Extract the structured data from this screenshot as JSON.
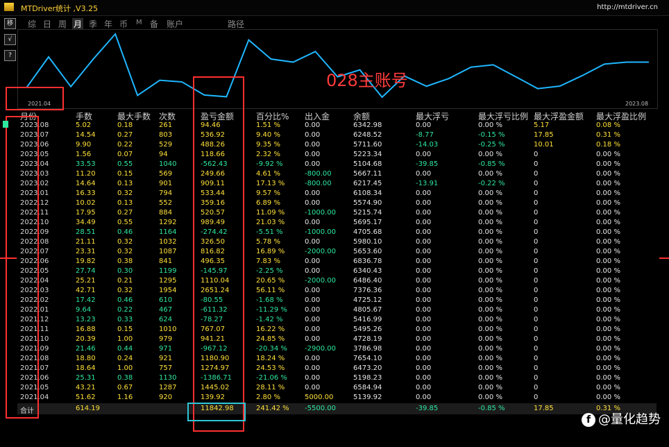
{
  "window": {
    "title": "MTDriver统计 ,V3.25",
    "url": "http://mtdriver.cn"
  },
  "toolbar": {
    "btn1": "移",
    "btn2": "√",
    "btn3": "?"
  },
  "nav": [
    "综",
    "日",
    "周",
    "月",
    "季",
    "年",
    "币",
    "M",
    "备",
    "账户",
    "路径"
  ],
  "nav_active": "月",
  "chart": {
    "start_label": "2021.04",
    "end_label": "2023.08",
    "account_label": "028主账号"
  },
  "chart_data": {
    "type": "line",
    "x": [
      "2021.04",
      "2021.05",
      "2021.06",
      "2021.07",
      "2021.08",
      "2021.09",
      "2021.10",
      "2021.11",
      "2021.12",
      "2022.01",
      "2022.02",
      "2022.03",
      "2022.04",
      "2022.05",
      "2022.06",
      "2022.07",
      "2022.08",
      "2022.09",
      "2022.10",
      "2022.11",
      "2022.12",
      "2023.01",
      "2023.02",
      "2023.03",
      "2023.04",
      "2023.05",
      "2023.06",
      "2023.07",
      "2023.08"
    ],
    "values": [
      5139.92,
      6584.94,
      5198.23,
      6473.2,
      7654.1,
      4786.98,
      5495.26,
      5416.99,
      4805.67,
      4725.12,
      7376.36,
      6486.4,
      6340.43,
      6836.78,
      5653.6,
      5980.1,
      4705.68,
      5695.17,
      5215.74,
      5574.9,
      6108.34,
      6217.45,
      5667.11,
      5104.68,
      5223.34,
      5711.6,
      6248.52,
      6342.98,
      6342.98
    ],
    "series_color": "#1fb6ff"
  },
  "table": {
    "headers": [
      "月份",
      "手数",
      "最大手数",
      "次数",
      "盈亏金额",
      "百分比%",
      "出入金",
      "余额",
      "最大浮亏",
      "最大浮亏比例",
      "最大浮盈金额",
      "最大浮盈比例"
    ],
    "rows": [
      {
        "month": "2023.08",
        "lots": "5.02",
        "max_lots": "0.18",
        "count": "261",
        "pl": "94.46",
        "pct": "1.51 %",
        "io": "0.00",
        "bal": "6342.98",
        "mdd": "0.00",
        "mdd_pct": "0.00 %",
        "mfp": "5.17",
        "mfp_pct": "0.08 %",
        "c": "y"
      },
      {
        "month": "2023.07",
        "lots": "14.54",
        "max_lots": "0.27",
        "count": "803",
        "pl": "536.92",
        "pct": "9.40 %",
        "io": "0.00",
        "bal": "6248.52",
        "mdd": "-8.77",
        "mdd_pct": "-0.15 %",
        "mfp": "17.85",
        "mfp_pct": "0.31 %",
        "c": "y"
      },
      {
        "month": "2023.06",
        "lots": "9.90",
        "max_lots": "0.22",
        "count": "529",
        "pl": "488.26",
        "pct": "9.35 %",
        "io": "0.00",
        "bal": "5711.60",
        "mdd": "-14.03",
        "mdd_pct": "-0.25 %",
        "mfp": "10.01",
        "mfp_pct": "0.18 %",
        "c": "y"
      },
      {
        "month": "2023.05",
        "lots": "1.56",
        "max_lots": "0.07",
        "count": "94",
        "pl": "118.66",
        "pct": "2.32 %",
        "io": "0.00",
        "bal": "5223.34",
        "mdd": "0.00",
        "mdd_pct": "0.00 %",
        "mfp": "0",
        "mfp_pct": "0.00 %",
        "c": "y"
      },
      {
        "month": "2023.04",
        "lots": "33.53",
        "max_lots": "0.55",
        "count": "1040",
        "pl": "-562.43",
        "pct": "-9.92 %",
        "io": "0.00",
        "bal": "5104.68",
        "mdd": "-39.85",
        "mdd_pct": "-0.85 %",
        "mfp": "0",
        "mfp_pct": "0.00 %",
        "c": "g"
      },
      {
        "month": "2023.03",
        "lots": "11.20",
        "max_lots": "0.15",
        "count": "569",
        "pl": "249.66",
        "pct": "4.61 %",
        "io": "-800.00",
        "bal": "5667.11",
        "mdd": "0.00",
        "mdd_pct": "0.00 %",
        "mfp": "0",
        "mfp_pct": "0.00 %",
        "c": "y"
      },
      {
        "month": "2023.02",
        "lots": "14.64",
        "max_lots": "0.13",
        "count": "901",
        "pl": "909.11",
        "pct": "17.13 %",
        "io": "-800.00",
        "bal": "6217.45",
        "mdd": "-13.91",
        "mdd_pct": "-0.22 %",
        "mfp": "0",
        "mfp_pct": "0.00 %",
        "c": "y"
      },
      {
        "month": "2023.01",
        "lots": "16.33",
        "max_lots": "0.32",
        "count": "794",
        "pl": "533.44",
        "pct": "9.57 %",
        "io": "0.00",
        "bal": "6108.34",
        "mdd": "0.00",
        "mdd_pct": "0.00 %",
        "mfp": "0",
        "mfp_pct": "0.00 %",
        "c": "y"
      },
      {
        "month": "2022.12",
        "lots": "10.02",
        "max_lots": "0.13",
        "count": "552",
        "pl": "359.16",
        "pct": "6.89 %",
        "io": "0.00",
        "bal": "5574.90",
        "mdd": "0.00",
        "mdd_pct": "0.00 %",
        "mfp": "0",
        "mfp_pct": "0.00 %",
        "c": "y"
      },
      {
        "month": "2022.11",
        "lots": "17.95",
        "max_lots": "0.27",
        "count": "884",
        "pl": "520.57",
        "pct": "11.09 %",
        "io": "-1000.00",
        "bal": "5215.74",
        "mdd": "0.00",
        "mdd_pct": "0.00 %",
        "mfp": "0",
        "mfp_pct": "0.00 %",
        "c": "y"
      },
      {
        "month": "2022.10",
        "lots": "34.49",
        "max_lots": "0.55",
        "count": "1292",
        "pl": "989.49",
        "pct": "21.03 %",
        "io": "0.00",
        "bal": "5695.17",
        "mdd": "0.00",
        "mdd_pct": "0.00 %",
        "mfp": "0",
        "mfp_pct": "0.00 %",
        "c": "y"
      },
      {
        "month": "2022.09",
        "lots": "28.51",
        "max_lots": "0.46",
        "count": "1164",
        "pl": "-274.42",
        "pct": "-5.51 %",
        "io": "-1000.00",
        "bal": "4705.68",
        "mdd": "0.00",
        "mdd_pct": "0.00 %",
        "mfp": "0",
        "mfp_pct": "0.00 %",
        "c": "g"
      },
      {
        "month": "2022.08",
        "lots": "21.11",
        "max_lots": "0.32",
        "count": "1032",
        "pl": "326.50",
        "pct": "5.78 %",
        "io": "0.00",
        "bal": "5980.10",
        "mdd": "0.00",
        "mdd_pct": "0.00 %",
        "mfp": "0",
        "mfp_pct": "0.00 %",
        "c": "y"
      },
      {
        "month": "2022.07",
        "lots": "23.31",
        "max_lots": "0.32",
        "count": "1087",
        "pl": "816.82",
        "pct": "16.89 %",
        "io": "-2000.00",
        "bal": "5653.60",
        "mdd": "0.00",
        "mdd_pct": "0.00 %",
        "mfp": "0",
        "mfp_pct": "0.00 %",
        "c": "y"
      },
      {
        "month": "2022.06",
        "lots": "19.82",
        "max_lots": "0.38",
        "count": "841",
        "pl": "496.35",
        "pct": "7.83 %",
        "io": "0.00",
        "bal": "6836.78",
        "mdd": "0.00",
        "mdd_pct": "0.00 %",
        "mfp": "0",
        "mfp_pct": "0.00 %",
        "c": "y"
      },
      {
        "month": "2022.05",
        "lots": "27.74",
        "max_lots": "0.30",
        "count": "1199",
        "pl": "-145.97",
        "pct": "-2.25 %",
        "io": "0.00",
        "bal": "6340.43",
        "mdd": "0.00",
        "mdd_pct": "0.00 %",
        "mfp": "0",
        "mfp_pct": "0.00 %",
        "c": "g"
      },
      {
        "month": "2022.04",
        "lots": "25.21",
        "max_lots": "0.21",
        "count": "1295",
        "pl": "1110.04",
        "pct": "20.65 %",
        "io": "-2000.00",
        "bal": "6486.40",
        "mdd": "0.00",
        "mdd_pct": "0.00 %",
        "mfp": "0",
        "mfp_pct": "0.00 %",
        "c": "y"
      },
      {
        "month": "2022.03",
        "lots": "42.71",
        "max_lots": "0.32",
        "count": "1954",
        "pl": "2651.24",
        "pct": "56.11 %",
        "io": "0.00",
        "bal": "7376.36",
        "mdd": "0.00",
        "mdd_pct": "0.00 %",
        "mfp": "0",
        "mfp_pct": "0.00 %",
        "c": "y"
      },
      {
        "month": "2022.02",
        "lots": "17.42",
        "max_lots": "0.46",
        "count": "610",
        "pl": "-80.55",
        "pct": "-1.68 %",
        "io": "0.00",
        "bal": "4725.12",
        "mdd": "0.00",
        "mdd_pct": "0.00 %",
        "mfp": "0",
        "mfp_pct": "0.00 %",
        "c": "g"
      },
      {
        "month": "2022.01",
        "lots": "9.64",
        "max_lots": "0.22",
        "count": "467",
        "pl": "-611.32",
        "pct": "-11.29 %",
        "io": "0.00",
        "bal": "4805.67",
        "mdd": "0.00",
        "mdd_pct": "0.00 %",
        "mfp": "0",
        "mfp_pct": "0.00 %",
        "c": "g"
      },
      {
        "month": "2021.12",
        "lots": "13.23",
        "max_lots": "0.33",
        "count": "624",
        "pl": "-78.27",
        "pct": "-1.42 %",
        "io": "0.00",
        "bal": "5416.99",
        "mdd": "0.00",
        "mdd_pct": "0.00 %",
        "mfp": "0",
        "mfp_pct": "0.00 %",
        "c": "g"
      },
      {
        "month": "2021.11",
        "lots": "16.88",
        "max_lots": "0.15",
        "count": "1010",
        "pl": "767.07",
        "pct": "16.22 %",
        "io": "0.00",
        "bal": "5495.26",
        "mdd": "0.00",
        "mdd_pct": "0.00 %",
        "mfp": "0",
        "mfp_pct": "0.00 %",
        "c": "y"
      },
      {
        "month": "2021.10",
        "lots": "20.39",
        "max_lots": "1.00",
        "count": "979",
        "pl": "941.21",
        "pct": "24.85 %",
        "io": "0.00",
        "bal": "4728.19",
        "mdd": "0.00",
        "mdd_pct": "0.00 %",
        "mfp": "0",
        "mfp_pct": "0.00 %",
        "c": "y"
      },
      {
        "month": "2021.09",
        "lots": "21.46",
        "max_lots": "0.44",
        "count": "971",
        "pl": "-967.12",
        "pct": "-20.34 %",
        "io": "-2900.00",
        "bal": "3786.98",
        "mdd": "0.00",
        "mdd_pct": "0.00 %",
        "mfp": "0",
        "mfp_pct": "0.00 %",
        "c": "g"
      },
      {
        "month": "2021.08",
        "lots": "18.80",
        "max_lots": "0.24",
        "count": "921",
        "pl": "1180.90",
        "pct": "18.24 %",
        "io": "0.00",
        "bal": "7654.10",
        "mdd": "0.00",
        "mdd_pct": "0.00 %",
        "mfp": "0",
        "mfp_pct": "0.00 %",
        "c": "y"
      },
      {
        "month": "2021.07",
        "lots": "18.64",
        "max_lots": "1.00",
        "count": "757",
        "pl": "1274.97",
        "pct": "24.53 %",
        "io": "0.00",
        "bal": "6473.20",
        "mdd": "0.00",
        "mdd_pct": "0.00 %",
        "mfp": "0",
        "mfp_pct": "0.00 %",
        "c": "y"
      },
      {
        "month": "2021.06",
        "lots": "25.31",
        "max_lots": "0.38",
        "count": "1130",
        "pl": "-1386.71",
        "pct": "-21.06 %",
        "io": "0.00",
        "bal": "5198.23",
        "mdd": "0.00",
        "mdd_pct": "0.00 %",
        "mfp": "0",
        "mfp_pct": "0.00 %",
        "c": "g"
      },
      {
        "month": "2021.05",
        "lots": "43.21",
        "max_lots": "0.67",
        "count": "1287",
        "pl": "1445.02",
        "pct": "28.11 %",
        "io": "0.00",
        "bal": "6584.94",
        "mdd": "0.00",
        "mdd_pct": "0.00 %",
        "mfp": "0",
        "mfp_pct": "0.00 %",
        "c": "y"
      },
      {
        "month": "2021.04",
        "lots": "51.62",
        "max_lots": "1.16",
        "count": "920",
        "pl": "139.92",
        "pct": "2.80 %",
        "io": "5000.00",
        "bal": "5139.92",
        "mdd": "0.00",
        "mdd_pct": "0.00 %",
        "mfp": "0",
        "mfp_pct": "0.00 %",
        "c": "y"
      }
    ],
    "total": {
      "label": "合计",
      "lots": "614.19",
      "pl": "11842.98",
      "pct": "241.42 %",
      "io": "-5500.00",
      "mdd": "-39.85",
      "mdd_pct": "-0.85 %",
      "mfp": "17.85",
      "mfp_pct": "0.31 %"
    }
  },
  "watermark": "@量化趋势",
  "colors": {
    "yellow": "#ffe03a",
    "green": "#2ee8a0",
    "red_box": "#ff3030",
    "cyan_box": "#2cc6d6"
  }
}
